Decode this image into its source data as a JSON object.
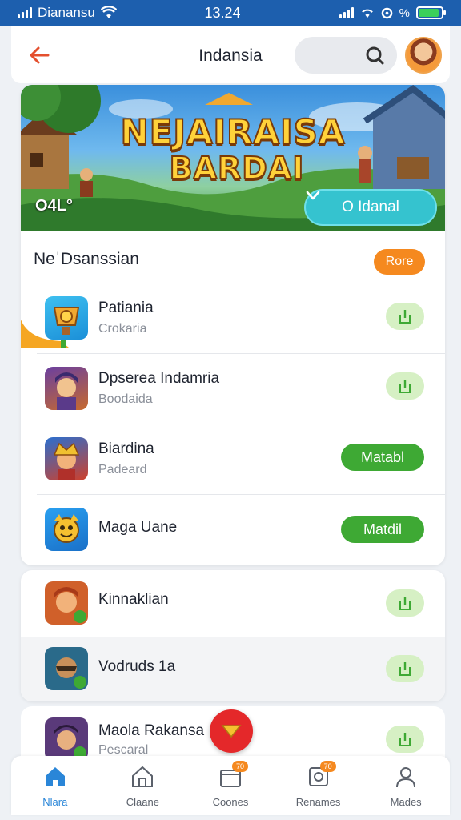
{
  "status_bar": {
    "carrier": "Dianansu",
    "time": "13.24",
    "battery_text": "%"
  },
  "header": {
    "title": "Indansia"
  },
  "banner": {
    "title_line1": "NEJAIRAISA",
    "title_line2": "BARDAI",
    "corner_text": "O4L°",
    "dropdown_label": "O Idanal"
  },
  "section": {
    "title": "NeˈDsanssian",
    "more_label": "Rore"
  },
  "apps": [
    {
      "name": "Patiania",
      "sub": "Crokaria",
      "action": "download"
    },
    {
      "name": "Dpserea Indamria",
      "sub": "Boodaida",
      "action": "download"
    },
    {
      "name": "Biardina",
      "sub": "Padeard",
      "action": "match",
      "action_label": "Matabl"
    },
    {
      "name": "Maga Uane",
      "sub": "",
      "action": "match",
      "action_label": "Matdil"
    }
  ],
  "apps2": [
    {
      "name": "Kinnaklian",
      "action": "download"
    },
    {
      "name": "Vodruds 1a",
      "action": "download"
    }
  ],
  "apps3": [
    {
      "name": "Maola Rakansa",
      "sub": "Pescaral",
      "action": "download"
    }
  ],
  "bottom_nav": [
    {
      "label": "Nlara",
      "icon": "home-icon",
      "active": true
    },
    {
      "label": "Claane",
      "icon": "store-icon"
    },
    {
      "label": "Coones",
      "icon": "box-icon",
      "badge": "70"
    },
    {
      "label": "Renames",
      "icon": "tablet-icon",
      "badge": "70"
    },
    {
      "label": "Mades",
      "icon": "user-icon"
    }
  ],
  "colors": {
    "accent": "#2a86d8",
    "orange": "#f5891f",
    "green": "#3ea934",
    "status_bar": "#1d5fae",
    "red": "#e4282a"
  }
}
